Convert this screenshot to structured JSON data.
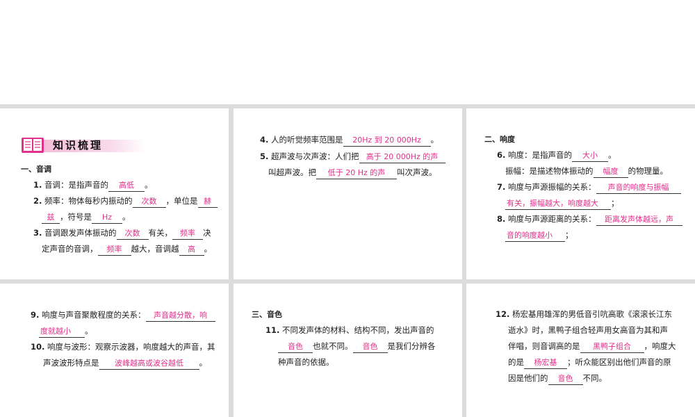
{
  "header": {
    "title": "知识梳理"
  },
  "sections": {
    "pitch": "一、音调",
    "loudness": "二、响度",
    "timbre": "三、音色"
  },
  "items": {
    "i1": {
      "num": "1.",
      "pre": "音调：是指声音的",
      "ans": "高低",
      "post": "。"
    },
    "i2": {
      "num": "2.",
      "pre": "频率：物体每秒内振动的",
      "ans1": "次数",
      "mid": "，单位是",
      "ans2a": "赫",
      "ans2b": "兹",
      "mid2": "，符号是",
      "ans3": "Hz",
      "post": "。"
    },
    "i3": {
      "num": "3.",
      "pre": "音调跟发声体振动的",
      "ans1": "次数",
      "mid": "有关，",
      "ans2": "频率",
      "mid2": "决",
      "pre2": "定声音的音调，",
      "ans3": "频率",
      "mid3": "越大，音调越",
      "ans4": "高",
      "post": "。"
    },
    "i4": {
      "num": "4.",
      "pre": "人的听觉频率范围是",
      "ans": "20Hz 到 20 000Hz",
      "post": "。"
    },
    "i5": {
      "num": "5.",
      "pre": "超声波与次声波：人们把",
      "ans1": "高于 20 000Hz 的声",
      "pre2": "叫超声波。把",
      "ans2": "低于 20 Hz 的声",
      "post": "叫次声波。"
    },
    "i6": {
      "num": "6.",
      "pre": "响度：是指声音的",
      "ans1": "大小",
      "post": "。",
      "pre2": "振幅：是描述物体振动的",
      "ans2": "幅度",
      "post2": "的物理量。"
    },
    "i7": {
      "num": "7.",
      "pre": "响度与声源振幅的关系：",
      "ans1": "声音的响度与振幅",
      "ans2": "有关，振幅越大，响度越大",
      "post": "；"
    },
    "i8": {
      "num": "8.",
      "pre": "响度与声源距离的关系：",
      "ans1": "距离发声体越远，声",
      "ans2": "音的响度越小",
      "post": "；"
    },
    "i9": {
      "num": "9.",
      "pre": "响度与声音聚散程度的关系：",
      "ans1": "声音越分散，响",
      "ans2": "度就越小",
      "post": "。"
    },
    "i10": {
      "num": "10.",
      "pre": "响度与波形：观察示波器，响度越大的声音，其",
      "pre2": "声波波形特点是",
      "ans": "波峰越高或波谷越低",
      "post": "。"
    },
    "i11": {
      "num": "11.",
      "pre": "不同发声体的材料、结构不同，发出声音的",
      "ans1": "音色",
      "mid": "也就不同。",
      "ans2": "音色",
      "mid2": "是我们分辨各",
      "pre3": "种声音的依据。"
    },
    "i12": {
      "num": "12.",
      "pre": "杨宏基用雄浑的男低音引吭高歌《滚滚长江东",
      "l2": "逝水》时，黑鸭子组合轻声用女高音为其和声",
      "l3pre": "伴唱，则音调高的是",
      "ans1": "黑鸭子组合",
      "l3post": "，响度大",
      "l4pre": "的是",
      "ans2": "杨宏基",
      "l4post": "；听众能区别出他们声音的原",
      "l5pre": "因是他们的",
      "ans3": "音色",
      "l5post": "不同。"
    }
  },
  "icons": {
    "book": "book-icon"
  },
  "colors": {
    "answer": "#e0308a",
    "banner": "#f4bcd8",
    "divider": "#dcdcdc"
  }
}
